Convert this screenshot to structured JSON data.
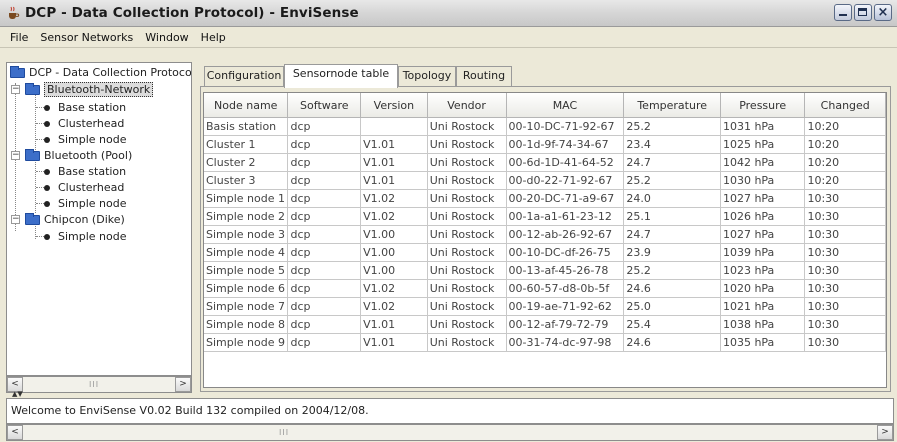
{
  "window": {
    "title": "DCP - Data Collection Protocol) - EnviSense",
    "icon": "java-cup-icon",
    "controls": [
      "minimize",
      "maximize",
      "close"
    ]
  },
  "menu": {
    "items": [
      "File",
      "Sensor Networks",
      "Window",
      "Help"
    ]
  },
  "tree": {
    "root": "DCP - Data Collection Protocol",
    "networks": [
      {
        "name": "Bluetooth-Network",
        "selected": true,
        "children": [
          "Base station",
          "Clusterhead",
          "Simple node"
        ]
      },
      {
        "name": "Bluetooth (Pool)",
        "selected": false,
        "children": [
          "Base station",
          "Clusterhead",
          "Simple node"
        ]
      },
      {
        "name": "Chipcon (Dike)",
        "selected": false,
        "children": [
          "Simple node"
        ]
      }
    ]
  },
  "tabs": [
    {
      "label": "Configuration",
      "active": false
    },
    {
      "label": "Sensornode table",
      "active": true
    },
    {
      "label": "Topology",
      "active": false
    },
    {
      "label": "Routing",
      "active": false
    }
  ],
  "table": {
    "columns": [
      "Node name",
      "Software",
      "Version",
      "Vendor",
      "MAC",
      "Temperature",
      "Pressure",
      "Changed"
    ],
    "rows": [
      [
        "Basis station",
        "dcp",
        "",
        "Uni Rostock",
        "00-10-DC-71-92-67",
        "25.2",
        "1031 hPa",
        "10:20"
      ],
      [
        "Cluster 1",
        "dcp",
        "V1.01",
        "Uni Rostock",
        "00-1d-9f-74-34-67",
        "23.4",
        "1025 hPa",
        "10:20"
      ],
      [
        "Cluster 2",
        "dcp",
        "V1.01",
        "Uni Rostock",
        "00-6d-1D-41-64-52",
        "24.7",
        "1042 hPa",
        "10:20"
      ],
      [
        "Cluster 3",
        "dcp",
        "V1.01",
        "Uni Rostock",
        "00-d0-22-71-92-67",
        "25.2",
        "1030 hPa",
        "10:20"
      ],
      [
        "Simple node 1",
        "dcp",
        "V1.02",
        "Uni Rostock",
        "00-20-DC-71-a9-67",
        "24.0",
        "1027 hPa",
        "10:30"
      ],
      [
        "Simple node 2",
        "dcp",
        "V1.02",
        "Uni Rostock",
        "00-1a-a1-61-23-12",
        "25.1",
        "1026 hPa",
        "10:30"
      ],
      [
        "Simple node 3",
        "dcp",
        "V1.00",
        "Uni Rostock",
        "00-12-ab-26-92-67",
        "24.7",
        "1027 hPa",
        "10:30"
      ],
      [
        "Simple node 4",
        "dcp",
        "V1.00",
        "Uni Rostock",
        "00-10-DC-df-26-75",
        "23.9",
        "1039 hPa",
        "10:30"
      ],
      [
        "Simple node 5",
        "dcp",
        "V1.00",
        "Uni Rostock",
        "00-13-af-45-26-78",
        "25.2",
        "1023 hPa",
        "10:30"
      ],
      [
        "Simple node 6",
        "dcp",
        "V1.02",
        "Uni Rostock",
        "00-60-57-d8-0b-5f",
        "24.6",
        "1020 hPa",
        "10:30"
      ],
      [
        "Simple node 7",
        "dcp",
        "V1.02",
        "Uni Rostock",
        "00-19-ae-71-92-62",
        "25.0",
        "1021 hPa",
        "10:30"
      ],
      [
        "Simple node 8",
        "dcp",
        "V1.01",
        "Uni Rostock",
        "00-12-af-79-72-79",
        "25.4",
        "1038 hPa",
        "10:30"
      ],
      [
        "Simple node 9",
        "dcp",
        "V1.01",
        "Uni Rostock",
        "00-31-74-dc-97-98",
        "24.6",
        "1035 hPa",
        "10:30"
      ]
    ]
  },
  "status": {
    "message": "Welcome to EnviSense V0.02 Build 132 compiled on 2004/12/08."
  },
  "scroll": {
    "left_arrow": "<",
    "right_arrow": ">",
    "grip": "III"
  }
}
